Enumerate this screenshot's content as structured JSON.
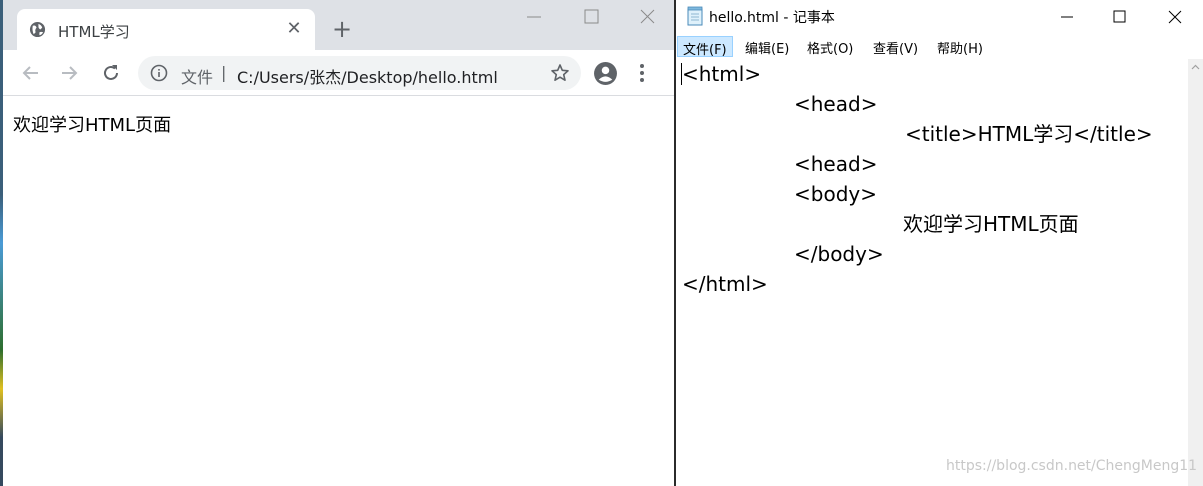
{
  "chrome": {
    "tab_title": "HTML学习",
    "tab_close": "✕",
    "new_tab": "+",
    "omnibox_scheme": "文件",
    "omnibox_separator": "|",
    "url": "C:/Users/张杰/Desktop/hello.html",
    "page_content": "欢迎学习HTML页面"
  },
  "notepad": {
    "title": "hello.html - 记事本",
    "menu": {
      "file": "文件(F)",
      "edit": "编辑(E)",
      "format": "格式(O)",
      "view": "查看(V)",
      "help": "帮助(H)"
    },
    "lines": [
      "<html>",
      "<head>",
      "<title>HTML学习</title>",
      "<head>",
      "<body>",
      "欢迎学习HTML页面",
      "</body>",
      "</html>"
    ]
  },
  "watermark": "https://blog.csdn.net/ChengMeng11"
}
